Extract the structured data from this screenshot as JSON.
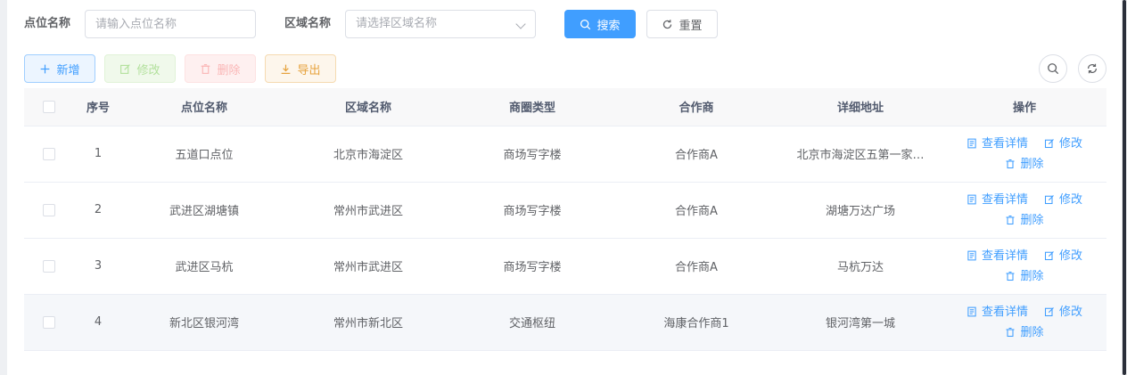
{
  "search_form": {
    "point_name_label": "点位名称",
    "point_name_placeholder": "请输入点位名称",
    "area_name_label": "区域名称",
    "area_name_placeholder": "请选择区域名称",
    "search_button": "搜索",
    "reset_button": "重置"
  },
  "toolbar": {
    "add_button": "新增",
    "edit_button": "修改",
    "delete_button": "删除",
    "export_button": "导出"
  },
  "table": {
    "columns": [
      "序号",
      "点位名称",
      "区域名称",
      "商圈类型",
      "合作商",
      "详细地址",
      "操作"
    ],
    "rows": [
      {
        "index": "1",
        "point_name": "五道口点位",
        "area": "北京市海淀区",
        "type": "商场写字楼",
        "partner": "合作商A",
        "address": "北京市海淀区五第一家…"
      },
      {
        "index": "2",
        "point_name": "武进区湖塘镇",
        "area": "常州市武进区",
        "type": "商场写字楼",
        "partner": "合作商A",
        "address": "湖塘万达广场"
      },
      {
        "index": "3",
        "point_name": "武进区马杭",
        "area": "常州市武进区",
        "type": "商场写字楼",
        "partner": "合作商A",
        "address": "马杭万达"
      },
      {
        "index": "4",
        "point_name": "新北区银河湾",
        "area": "常州市新北区",
        "type": "交通枢纽",
        "partner": "海康合作商1",
        "address": "银河湾第一城"
      }
    ],
    "ops": {
      "view": "查看详情",
      "edit": "修改",
      "delete": "删除"
    }
  },
  "colors": {
    "primary": "#409eff",
    "warning": "#e6a23c",
    "danger": "#f56c6c",
    "success": "#67c23a"
  }
}
